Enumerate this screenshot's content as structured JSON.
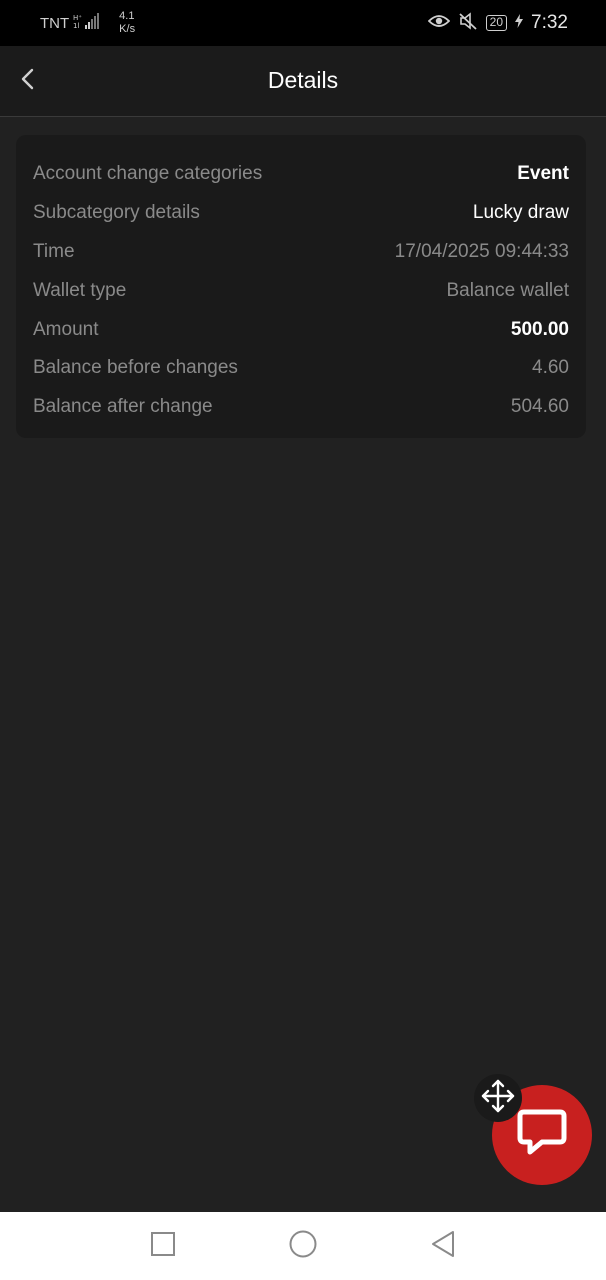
{
  "status_bar": {
    "carrier": "TNT",
    "net_speed_value": "4.1",
    "net_speed_unit": "K/s",
    "battery": "20",
    "time": "7:32"
  },
  "header": {
    "title": "Details"
  },
  "details": {
    "rows": [
      {
        "label": "Account change categories",
        "value": "Event"
      },
      {
        "label": "Subcategory details",
        "value": "Lucky draw"
      },
      {
        "label": "Time",
        "value": "17/04/2025 09:44:33"
      },
      {
        "label": "Wallet type",
        "value": "Balance wallet"
      },
      {
        "label": "Amount",
        "value": "500.00"
      },
      {
        "label": "Balance before changes",
        "value": "4.60"
      },
      {
        "label": "Balance after change",
        "value": "504.60"
      }
    ]
  },
  "colors": {
    "background": "#212121",
    "card": "#1a1a1a",
    "accent_red": "#c8201f",
    "muted_text": "#8a8a8a"
  },
  "icons": {
    "back": "chevron-left-icon",
    "move": "move-arrows-icon",
    "chat": "chat-bubble-icon",
    "nav_recent": "square-icon",
    "nav_home": "circle-icon",
    "nav_back": "triangle-back-icon"
  }
}
